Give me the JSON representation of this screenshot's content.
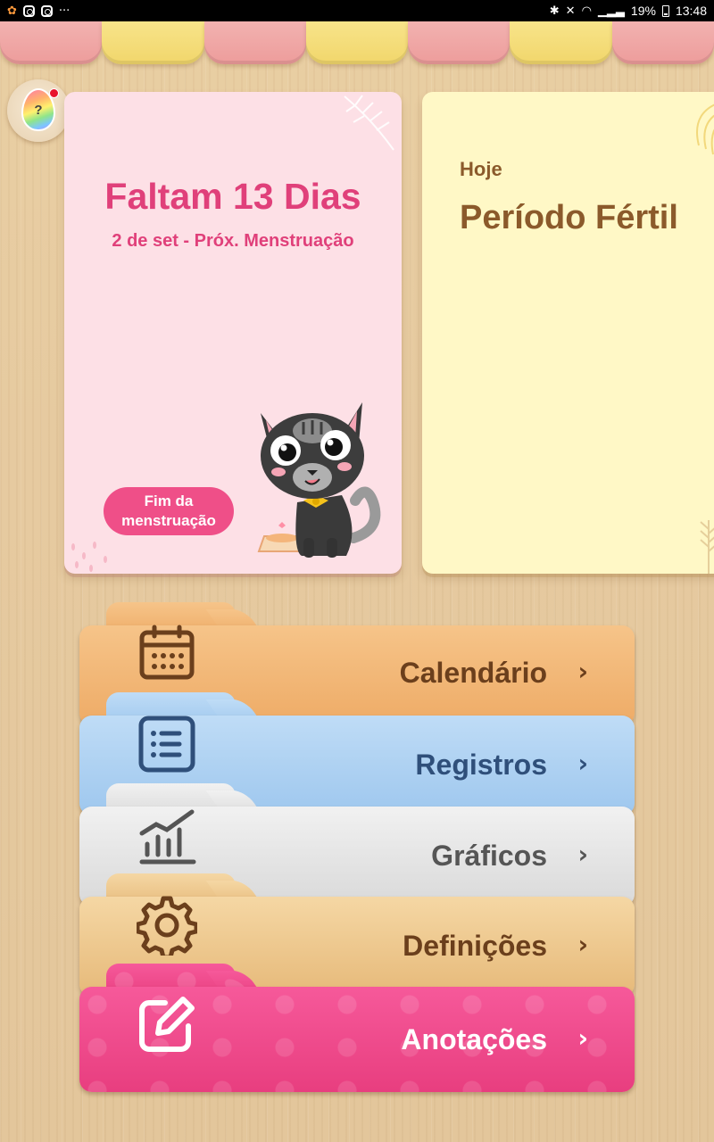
{
  "status_bar": {
    "time": "13:48",
    "battery": "19%"
  },
  "help": {
    "symbol": "?"
  },
  "cycle_card": {
    "countdown": "Faltam 13 Dias",
    "next_period": "2 de set - Próx. Menstruação",
    "end_button_line1": "Fim da",
    "end_button_line2": "menstruação"
  },
  "today_card": {
    "label": "Hoje",
    "status": "Período Fértil"
  },
  "menu": {
    "items": [
      {
        "label": "Calendário",
        "icon": "calendar-icon",
        "color": "#eeab66"
      },
      {
        "label": "Registros",
        "icon": "list-icon",
        "color": "#9ec7ee"
      },
      {
        "label": "Gráficos",
        "icon": "chart-icon",
        "color": "#d9d9d9"
      },
      {
        "label": "Definições",
        "icon": "gear-icon",
        "color": "#e6b979"
      },
      {
        "label": "Anotações",
        "icon": "edit-icon",
        "color": "#e83e7f"
      }
    ],
    "chevron": "›"
  },
  "colors": {
    "accent_pink": "#e0407a",
    "brown_text": "#8b5a2b"
  }
}
